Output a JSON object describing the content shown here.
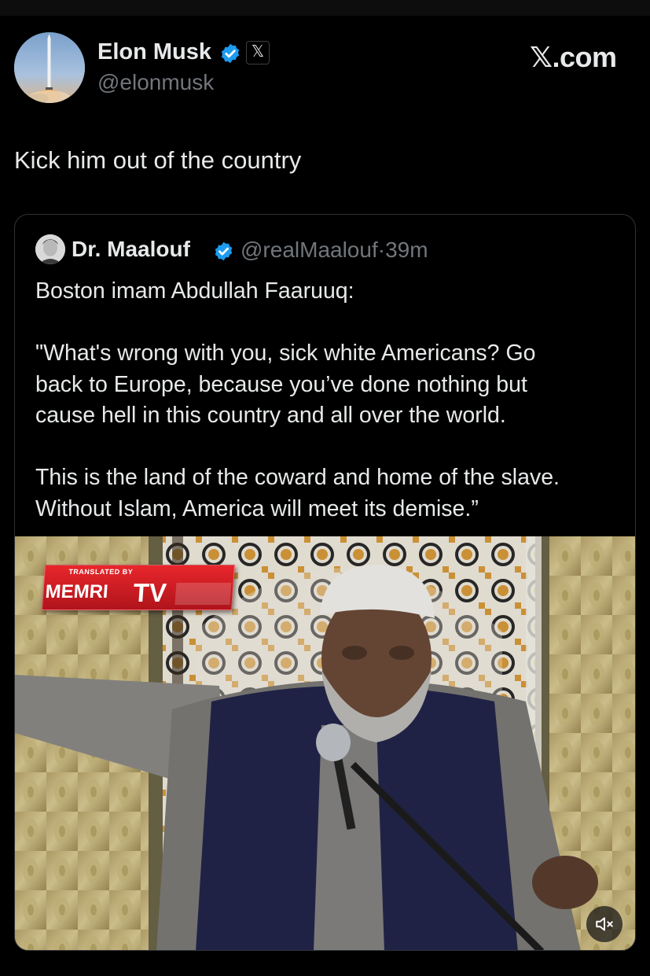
{
  "author": {
    "name": "Elon Musk",
    "handle": "@elonmusk",
    "verified_icon": "verified-badge-icon",
    "affiliate_badge": "𝕏"
  },
  "brand": "𝕏.com",
  "tweet": {
    "text": "Kick him out of the country"
  },
  "quoted_tweet": {
    "name": "Dr. Maalouf",
    "handle": "@realMaalouf",
    "separator": "·",
    "time": "39m",
    "paragraphs": [
      "Boston imam Abdullah Faaruuq:",
      "\"What's wrong with you, sick white Americans? Go\nback to Europe, because you’ve done nothing but\ncause hell in this country and all over the world.",
      "This is the land of the coward and home of the slave.\nWithout Islam, America will meet its demise.”"
    ],
    "media": {
      "watermark_sub": "TRANSLATED BY",
      "watermark_main": "MEMRI",
      "watermark_tv": "TV",
      "mute_icon": "muted-speaker-icon"
    }
  },
  "colors": {
    "background": "#000000",
    "text_primary": "#e7e9ea",
    "text_secondary": "#71767b",
    "verified_blue": "#1d9bf0",
    "border": "#2f3336",
    "memri_red": "#d01f26"
  }
}
